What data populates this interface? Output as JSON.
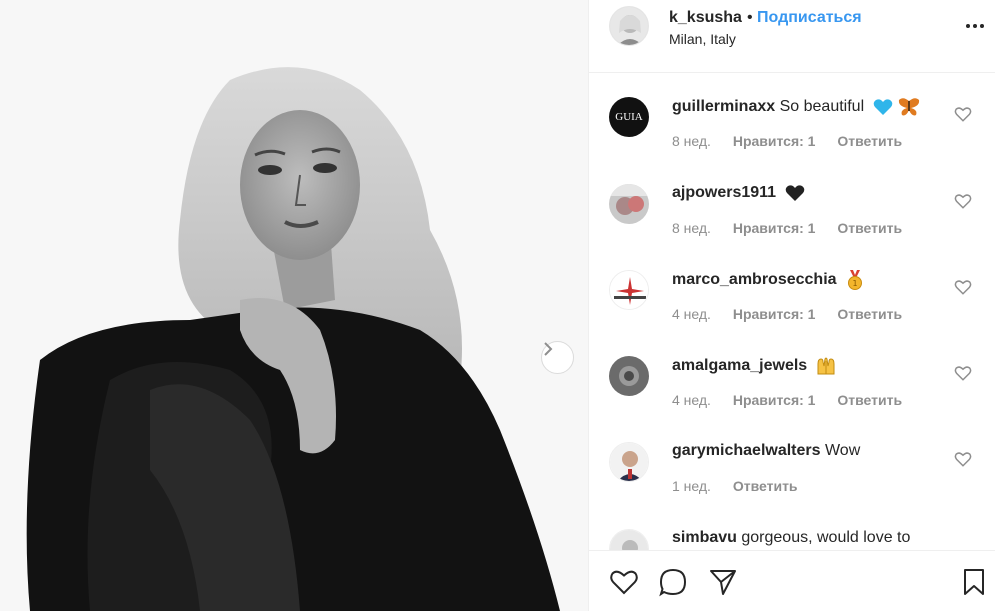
{
  "post": {
    "username": "k_ksusha",
    "separator": "•",
    "follow_label": "Подписаться",
    "location": "Milan, Italy"
  },
  "comments": [
    {
      "username": "guillerminaxx",
      "text": "So beautiful",
      "emoji": [
        "blue-heart",
        "butterfly"
      ],
      "time": "8 нед.",
      "likes": "Нравится: 1",
      "reply": "Ответить",
      "avatar_text": "GUIA"
    },
    {
      "username": "ajpowers1911",
      "text": "",
      "emoji": [
        "black-heart"
      ],
      "time": "8 нед.",
      "likes": "Нравится: 1",
      "reply": "Ответить"
    },
    {
      "username": "marco_ambrosecchia",
      "text": "",
      "emoji": [
        "medal"
      ],
      "time": "4 нед.",
      "likes": "Нравится: 1",
      "reply": "Ответить"
    },
    {
      "username": "amalgama_jewels",
      "text": "",
      "emoji": [
        "raised-hands"
      ],
      "time": "4 нед.",
      "likes": "Нравится: 1",
      "reply": "Ответить"
    },
    {
      "username": "garymichaelwalters",
      "text": "Wow",
      "emoji": [],
      "time": "1 нед.",
      "likes": "",
      "reply": "Ответить"
    },
    {
      "username": "simbavu",
      "text": "gorgeous, would love to",
      "emoji": [],
      "time": "",
      "likes": "",
      "reply": ""
    }
  ],
  "actions": {
    "icons": [
      "heart-outline-icon",
      "comment-icon",
      "share-icon",
      "bookmark-icon"
    ]
  },
  "colors": {
    "accent": "#3897f0",
    "text": "#262626",
    "muted": "#8e8e8e",
    "border": "#efefef"
  }
}
